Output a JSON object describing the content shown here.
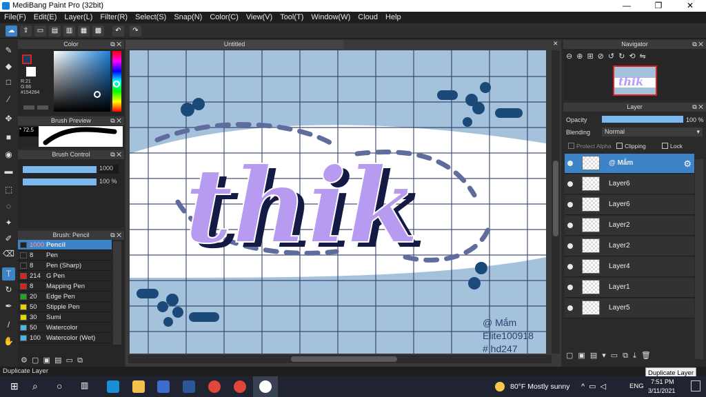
{
  "window": {
    "title": "MediBang Paint Pro (32bit)",
    "min": "—",
    "max": "❐",
    "close": "✕"
  },
  "menu": [
    "File(F)",
    "Edit(E)",
    "Layer(L)",
    "Filter(R)",
    "Select(S)",
    "Snap(N)",
    "Color(C)",
    "View(V)",
    "Tool(T)",
    "Window(W)",
    "Cloud",
    "Help"
  ],
  "color_panel": {
    "title": "Color",
    "r": "R:21",
    "g": "G:66",
    "hex": "#154264",
    "fg": "#154264"
  },
  "brush_preview": {
    "title": "Brush Preview",
    "size": "* 72.5"
  },
  "brush_control": {
    "title": "Brush Control",
    "size_value": "1000",
    "opacity_value": "100 %"
  },
  "brush_list": {
    "title": "Brush: Pencil",
    "items": [
      {
        "size": "1000",
        "name": "Pencil",
        "color": "#222222"
      },
      {
        "size": "8",
        "name": "Pen",
        "color": "#222222"
      },
      {
        "size": "8",
        "name": "Pen (Sharp)",
        "color": "#222222"
      },
      {
        "size": "214",
        "name": "G Pen",
        "color": "#e02020"
      },
      {
        "size": "8",
        "name": "Mapping Pen",
        "color": "#e02020"
      },
      {
        "size": "20",
        "name": "Edge Pen",
        "color": "#1fa81f"
      },
      {
        "size": "50",
        "name": "Stipple Pen",
        "color": "#e8d400"
      },
      {
        "size": "30",
        "name": "Sumi",
        "color": "#e8d400"
      },
      {
        "size": "50",
        "name": "Watercolor",
        "color": "#48b8e8"
      },
      {
        "size": "100",
        "name": "Watercolor (Wet)",
        "color": "#48b8e8"
      }
    ]
  },
  "canvas": {
    "tab": "Untitled",
    "art_text": "thik",
    "sig_line1": "@ Mắm",
    "sig_line2": "Elite100918",
    "sig_line3": "# hd247",
    "bg_color": "#a4c2dc",
    "band_color": "#ffffff"
  },
  "navigator": {
    "title": "Navigator"
  },
  "layer_panel": {
    "title": "Layer",
    "opacity_label": "Opacity",
    "opacity_value": "100 %",
    "opacity_level": 1.0,
    "blending_label": "Blending",
    "blending_value": "Normal",
    "protect_alpha": "Protect Alpha",
    "clipping": "Clipping",
    "lock": "Lock",
    "layers": [
      "@ Mắm",
      "Layer6",
      "Layer6",
      "Layer2",
      "Layer2",
      "Layer4",
      "Layer1",
      "Layer5"
    ]
  },
  "status": {
    "text": "Duplicate Layer",
    "tooltip": "Duplicate Layer"
  },
  "taskbar": {
    "weather": "80°F  Mostly sunny",
    "lang": "ENG",
    "time": "7:51 PM",
    "date": "3/11/2021"
  }
}
